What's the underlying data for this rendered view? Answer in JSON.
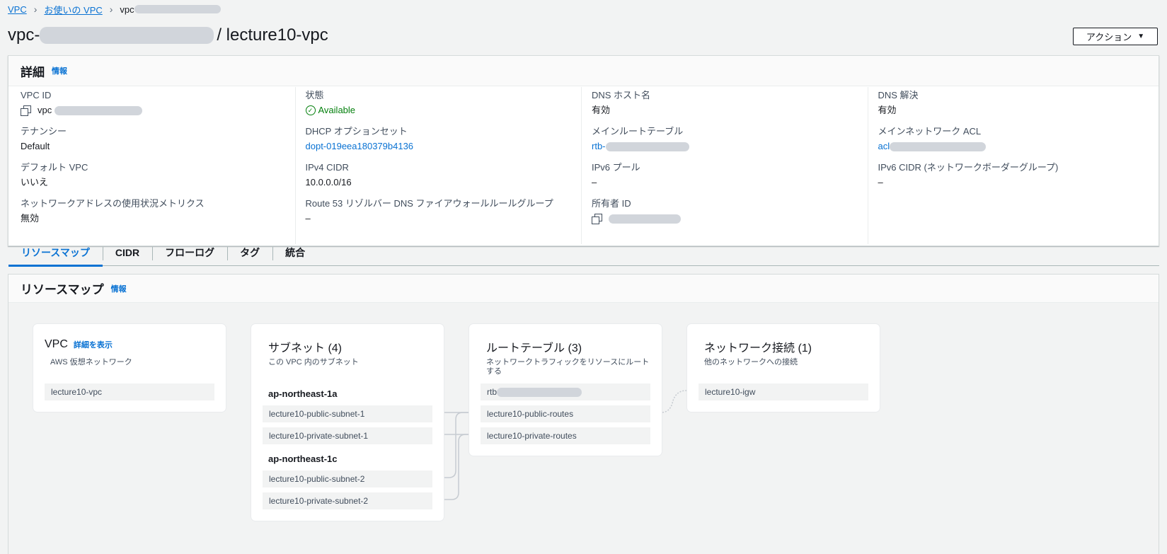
{
  "breadcrumb": {
    "item1": "VPC",
    "item2": "お使いの VPC",
    "current_prefix": "vpc"
  },
  "header": {
    "title_prefix": "vpc-",
    "title_suffix": "/ lecture10-vpc",
    "action_label": "アクション"
  },
  "details": {
    "title": "詳細",
    "info": "情報",
    "vpc_id_label": "VPC ID",
    "vpc_id_prefix": "vpc",
    "state_label": "状態",
    "state_value": "Available",
    "dns_hostname_label": "DNS ホスト名",
    "dns_hostname_value": "有効",
    "dns_resolution_label": "DNS 解決",
    "dns_resolution_value": "有効",
    "tenancy_label": "テナンシー",
    "tenancy_value": "Default",
    "dhcp_label": "DHCP オプションセット",
    "dhcp_value": "dopt-019eea180379b4136",
    "main_rt_label": "メインルートテーブル",
    "main_rt_prefix": "rtb-",
    "main_acl_label": "メインネットワーク ACL",
    "main_acl_prefix": "acl",
    "default_vpc_label": "デフォルト VPC",
    "default_vpc_value": "いいえ",
    "ipv4_cidr_label": "IPv4 CIDR",
    "ipv4_cidr_value": "10.0.0.0/16",
    "ipv6_pool_label": "IPv6 プール",
    "ipv6_pool_value": "–",
    "ipv6_cidr_label": "IPv6 CIDR (ネットワークボーダーグループ)",
    "ipv6_cidr_value": "–",
    "net_metrics_label": "ネットワークアドレスの使用状況メトリクス",
    "net_metrics_value": "無効",
    "route53_label": "Route 53 リゾルバー DNS ファイアウォールルールグループ",
    "route53_value": "–",
    "owner_label": "所有者 ID"
  },
  "tabs": [
    "リソースマップ",
    "CIDR",
    "フローログ",
    "タグ",
    "統合"
  ],
  "resource_map": {
    "title": "リソースマップ",
    "info": "情報",
    "vpc_card": {
      "title": "VPC",
      "detail_link": "詳細を表示",
      "subtitle": "AWS 仮想ネットワーク",
      "item": "lecture10-vpc"
    },
    "subnet_card": {
      "title": "サブネット (4)",
      "subtitle": "この VPC 内のサブネット",
      "az1": "ap-northeast-1a",
      "az2": "ap-northeast-1c",
      "items": [
        "lecture10-public-subnet-1",
        "lecture10-private-subnet-1",
        "lecture10-public-subnet-2",
        "lecture10-private-subnet-2"
      ]
    },
    "route_card": {
      "title": "ルートテーブル (3)",
      "subtitle_line1": "ネットワークトラフィックをリソースにルート",
      "subtitle_line2": "する",
      "main_prefix": "rtb",
      "items": [
        "lecture10-public-routes",
        "lecture10-private-routes"
      ]
    },
    "network_card": {
      "title": "ネットワーク接続 (1)",
      "subtitle": "他のネットワークへの接続",
      "item": "lecture10-igw"
    }
  }
}
